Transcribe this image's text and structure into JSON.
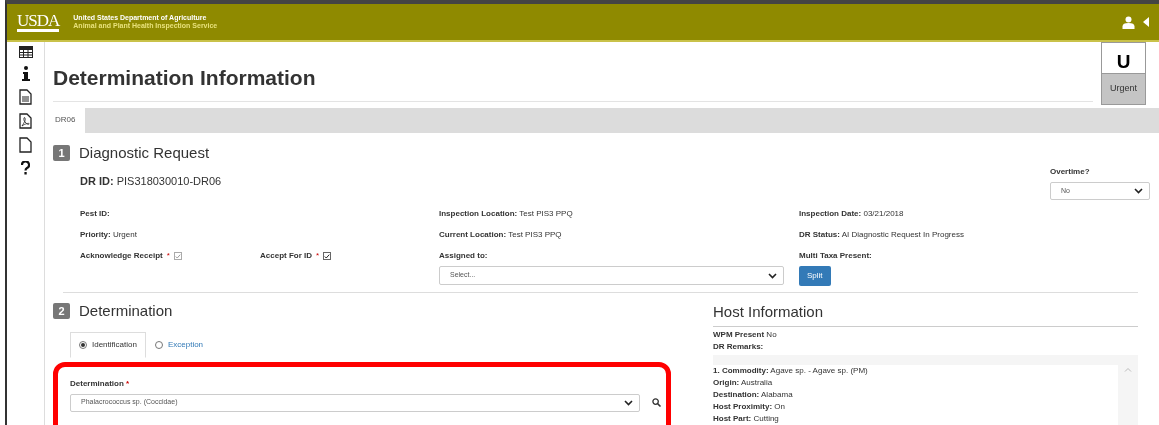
{
  "header": {
    "logo": "USDA",
    "org": "United States Department of Agriculture",
    "agency": "Animal and Plant Health Inspection Service"
  },
  "page_title": "Determination Information",
  "priority_badge": {
    "letter": "U",
    "label": "Urgent"
  },
  "tabs": [
    {
      "label": "DR06",
      "selected": true
    }
  ],
  "section1": {
    "number": "1",
    "title": "Diagnostic Request",
    "dr_id_label": "DR ID:",
    "dr_id": "PIS318030010-DR06",
    "overtime": {
      "label": "Overtime?",
      "value": "No"
    },
    "rows": [
      [
        {
          "kind": "text",
          "label": "Pest ID:"
        },
        {
          "kind": "text",
          "label": "Inspection Location:",
          "value": "Test PIS3 PPQ"
        },
        {
          "kind": "text",
          "label": "Inspection Date:",
          "value": "03/21/2018"
        }
      ],
      [
        {
          "kind": "text",
          "label": "Priority:",
          "value": "Urgent"
        },
        {
          "kind": "text",
          "label": "Current Location:",
          "value": "Test PIS3 PPQ"
        },
        {
          "kind": "text",
          "label": "DR Status:",
          "value": "AI Diagnostic Request In Progress"
        }
      ],
      [
        {
          "kind": "checkboxes",
          "items": [
            {
              "label": "Acknowledge Receipt",
              "required": "*",
              "checked": true,
              "disabled": true
            },
            {
              "label": "Accept For ID",
              "required": "*",
              "checked": true,
              "disabled": false
            }
          ]
        },
        {
          "kind": "select",
          "label": "Assigned to:",
          "placeholder": "Select..."
        },
        {
          "kind": "button",
          "label": "Multi Taxa Present:",
          "button": "Split"
        }
      ]
    ]
  },
  "section2": {
    "number": "2",
    "title": "Determination",
    "options": [
      {
        "label": "Identification",
        "selected": true
      },
      {
        "label": "Exception",
        "selected": false
      }
    ],
    "determination": {
      "label": "Determination",
      "required": "*",
      "value": "Phalacrococcus sp. (Coccidae)"
    }
  },
  "host": {
    "title": "Host Information",
    "fields": [
      {
        "label": "WPM Present",
        "value": "No"
      },
      {
        "label": "DR Remarks:"
      }
    ],
    "entries": [
      {
        "label": "1. Commodity:",
        "value": "Agave sp. - Agave sp. (PM)"
      },
      {
        "label": "Origin:",
        "value": "Australia"
      },
      {
        "label": "Destination:",
        "value": "Alabama"
      },
      {
        "label": "Host Proximity:",
        "value": "On"
      },
      {
        "label": "Host Part:",
        "value": "Cutting"
      }
    ]
  }
}
